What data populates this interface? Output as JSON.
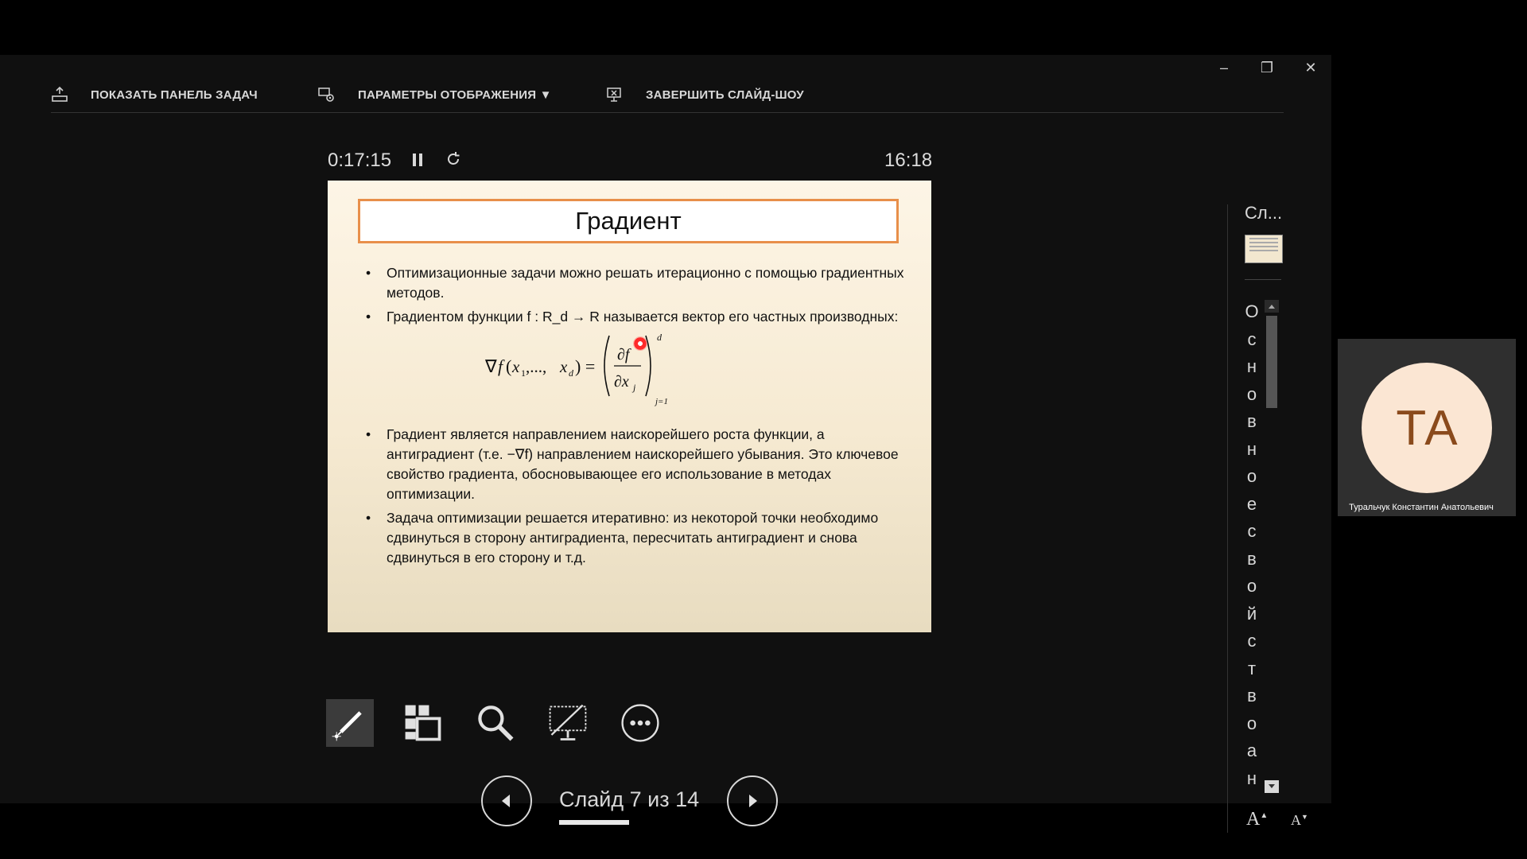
{
  "toolbar": {
    "show_taskbar": "ПОКАЗАТЬ ПАНЕЛЬ ЗАДАЧ",
    "display_settings": "ПАРАМЕТРЫ ОТОБРАЖЕНИЯ ▼",
    "end_show": "ЗАВЕРШИТЬ СЛАЙД-ШОУ"
  },
  "window": {
    "minimize": "–",
    "restore": "❐",
    "close": "✕"
  },
  "presenter": {
    "elapsed": "0:17:15",
    "clock": "16:18"
  },
  "slide": {
    "title": "Градиент",
    "bullet1": "Оптимизационные задачи можно решать итерационно с помощью градиентных методов.",
    "bullet2": "Градиентом функции f : R_d → R называется вектор его частных производных:",
    "bullet3": "Градиент является направлением наискорейшего роста функции, а антиградиент (т.е. −∇f) направлением наискорейшего убывания. Это ключевое свойство градиента, обосновывающее его использование в методах оптимизации.",
    "bullet4": "Задача оптимизации решается итеративно: из некоторой точки необходимо сдвинуться в сторону антиградиента, пересчитать антиградиент и снова сдвинуться в его сторону и т.д."
  },
  "navigation": {
    "counter": "Слайд 7 из 14",
    "progress_fraction": 0.5
  },
  "notes": {
    "header": "Сл...",
    "letters": [
      "О",
      "с",
      "н",
      "о",
      "в",
      "н",
      "о",
      "е",
      "с",
      "в",
      "о",
      "й",
      "с",
      "т",
      "в",
      "о",
      "а",
      "н"
    ]
  },
  "font_controls": {
    "increase": "A",
    "decrease": "A"
  },
  "participant": {
    "initials": "ТА",
    "name": "Туральчук Константин Анатольевич"
  }
}
